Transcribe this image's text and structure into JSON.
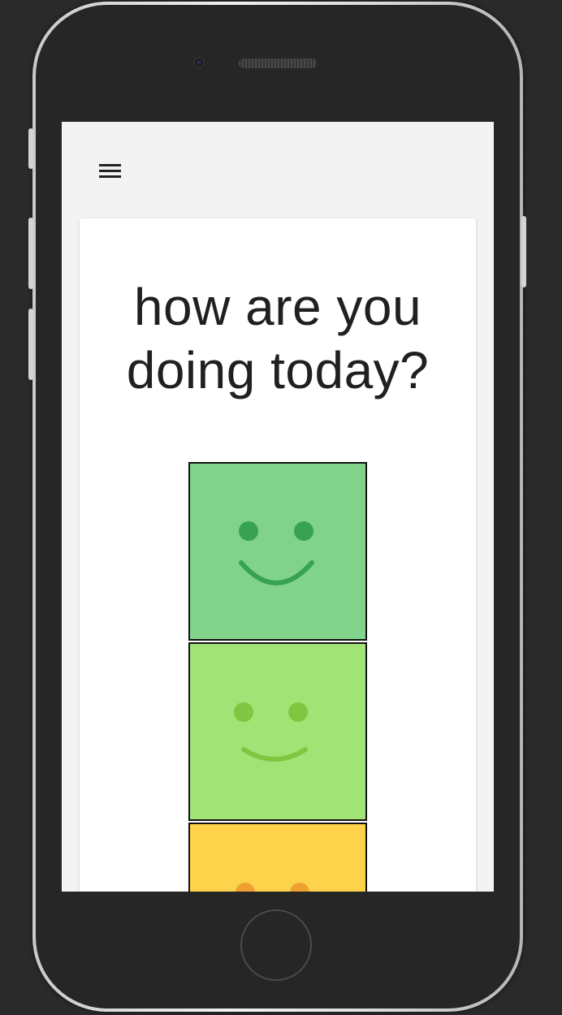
{
  "screen": {
    "menu_icon": "hamburger-menu-icon",
    "question": "how are you doing today?"
  },
  "moods": [
    {
      "id": "great",
      "icon": "big-smile-icon",
      "background": "#81d38c",
      "feature": "#37a253"
    },
    {
      "id": "good",
      "icon": "smile-icon",
      "background": "#a1e375",
      "feature": "#82c541"
    },
    {
      "id": "okay",
      "icon": "neutral-face-icon",
      "background": "#fcd34b",
      "feature": "#f0a030"
    }
  ]
}
